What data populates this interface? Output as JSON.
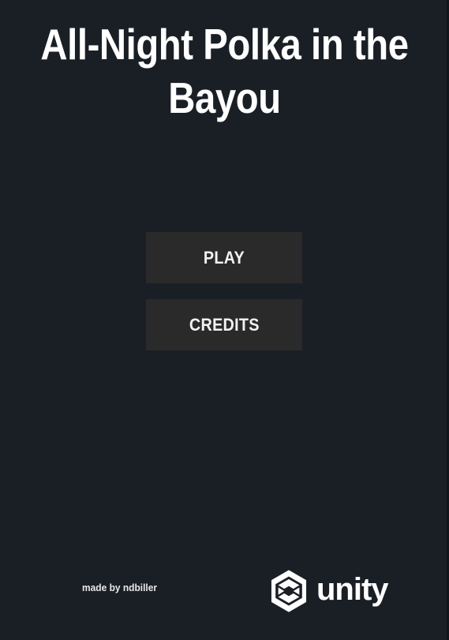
{
  "title": {
    "line1": "All-Night Polka in the",
    "line2": "Bayou"
  },
  "menu": {
    "play_label": "PLAY",
    "credits_label": "CREDITS"
  },
  "footer": {
    "credit": "made by ndbiller",
    "engine_logo_text": "unity",
    "engine_logo_icon": "unity-cube-icon"
  },
  "colors": {
    "background": "#1a1f26",
    "button": "#2a2a2b",
    "text": "#ffffff"
  }
}
